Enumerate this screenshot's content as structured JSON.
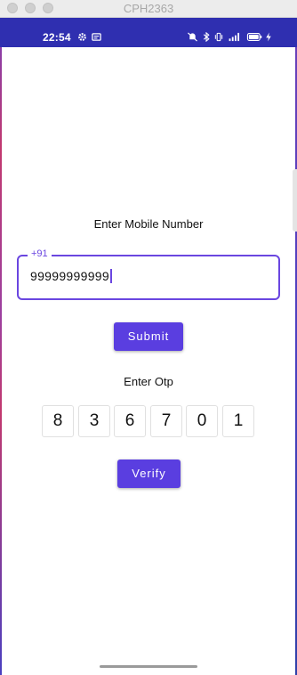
{
  "window": {
    "title": "CPH2363"
  },
  "status_bar": {
    "time": "22:54",
    "left_icons": [
      "gear-icon",
      "notification-icon"
    ],
    "right_icons": [
      "mute-alarm-icon",
      "bluetooth-icon",
      "vibrate-icon",
      "signal-icon",
      "battery-icon",
      "charging-icon"
    ],
    "background": "#2f2fb0"
  },
  "form": {
    "mobile_label": "Enter Mobile Number",
    "country_code": "+91",
    "mobile_value": "99999999999",
    "submit_label": "Submit",
    "otp_label": "Enter Otp",
    "otp_digits": [
      "8",
      "3",
      "6",
      "7",
      "0",
      "1"
    ],
    "verify_label": "Verify"
  },
  "colors": {
    "accent": "#6a46e0",
    "button": "#5a3ee0"
  }
}
